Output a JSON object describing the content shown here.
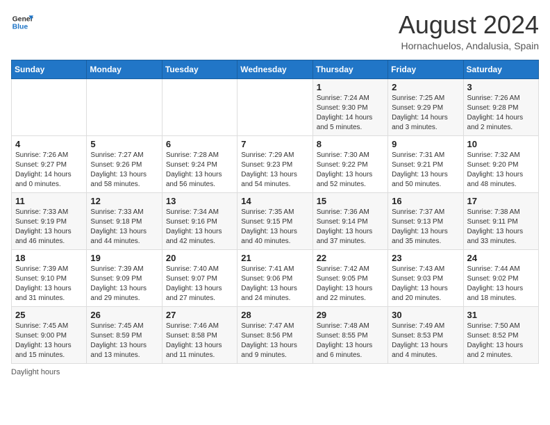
{
  "header": {
    "logo_line1": "General",
    "logo_line2": "Blue",
    "main_title": "August 2024",
    "subtitle": "Hornachuelos, Andalusia, Spain"
  },
  "days_of_week": [
    "Sunday",
    "Monday",
    "Tuesday",
    "Wednesday",
    "Thursday",
    "Friday",
    "Saturday"
  ],
  "weeks": [
    [
      {
        "day": "",
        "info": ""
      },
      {
        "day": "",
        "info": ""
      },
      {
        "day": "",
        "info": ""
      },
      {
        "day": "",
        "info": ""
      },
      {
        "day": "1",
        "info": "Sunrise: 7:24 AM\nSunset: 9:30 PM\nDaylight: 14 hours\nand 5 minutes."
      },
      {
        "day": "2",
        "info": "Sunrise: 7:25 AM\nSunset: 9:29 PM\nDaylight: 14 hours\nand 3 minutes."
      },
      {
        "day": "3",
        "info": "Sunrise: 7:26 AM\nSunset: 9:28 PM\nDaylight: 14 hours\nand 2 minutes."
      }
    ],
    [
      {
        "day": "4",
        "info": "Sunrise: 7:26 AM\nSunset: 9:27 PM\nDaylight: 14 hours\nand 0 minutes."
      },
      {
        "day": "5",
        "info": "Sunrise: 7:27 AM\nSunset: 9:26 PM\nDaylight: 13 hours\nand 58 minutes."
      },
      {
        "day": "6",
        "info": "Sunrise: 7:28 AM\nSunset: 9:24 PM\nDaylight: 13 hours\nand 56 minutes."
      },
      {
        "day": "7",
        "info": "Sunrise: 7:29 AM\nSunset: 9:23 PM\nDaylight: 13 hours\nand 54 minutes."
      },
      {
        "day": "8",
        "info": "Sunrise: 7:30 AM\nSunset: 9:22 PM\nDaylight: 13 hours\nand 52 minutes."
      },
      {
        "day": "9",
        "info": "Sunrise: 7:31 AM\nSunset: 9:21 PM\nDaylight: 13 hours\nand 50 minutes."
      },
      {
        "day": "10",
        "info": "Sunrise: 7:32 AM\nSunset: 9:20 PM\nDaylight: 13 hours\nand 48 minutes."
      }
    ],
    [
      {
        "day": "11",
        "info": "Sunrise: 7:33 AM\nSunset: 9:19 PM\nDaylight: 13 hours\nand 46 minutes."
      },
      {
        "day": "12",
        "info": "Sunrise: 7:33 AM\nSunset: 9:18 PM\nDaylight: 13 hours\nand 44 minutes."
      },
      {
        "day": "13",
        "info": "Sunrise: 7:34 AM\nSunset: 9:16 PM\nDaylight: 13 hours\nand 42 minutes."
      },
      {
        "day": "14",
        "info": "Sunrise: 7:35 AM\nSunset: 9:15 PM\nDaylight: 13 hours\nand 40 minutes."
      },
      {
        "day": "15",
        "info": "Sunrise: 7:36 AM\nSunset: 9:14 PM\nDaylight: 13 hours\nand 37 minutes."
      },
      {
        "day": "16",
        "info": "Sunrise: 7:37 AM\nSunset: 9:13 PM\nDaylight: 13 hours\nand 35 minutes."
      },
      {
        "day": "17",
        "info": "Sunrise: 7:38 AM\nSunset: 9:11 PM\nDaylight: 13 hours\nand 33 minutes."
      }
    ],
    [
      {
        "day": "18",
        "info": "Sunrise: 7:39 AM\nSunset: 9:10 PM\nDaylight: 13 hours\nand 31 minutes."
      },
      {
        "day": "19",
        "info": "Sunrise: 7:39 AM\nSunset: 9:09 PM\nDaylight: 13 hours\nand 29 minutes."
      },
      {
        "day": "20",
        "info": "Sunrise: 7:40 AM\nSunset: 9:07 PM\nDaylight: 13 hours\nand 27 minutes."
      },
      {
        "day": "21",
        "info": "Sunrise: 7:41 AM\nSunset: 9:06 PM\nDaylight: 13 hours\nand 24 minutes."
      },
      {
        "day": "22",
        "info": "Sunrise: 7:42 AM\nSunset: 9:05 PM\nDaylight: 13 hours\nand 22 minutes."
      },
      {
        "day": "23",
        "info": "Sunrise: 7:43 AM\nSunset: 9:03 PM\nDaylight: 13 hours\nand 20 minutes."
      },
      {
        "day": "24",
        "info": "Sunrise: 7:44 AM\nSunset: 9:02 PM\nDaylight: 13 hours\nand 18 minutes."
      }
    ],
    [
      {
        "day": "25",
        "info": "Sunrise: 7:45 AM\nSunset: 9:00 PM\nDaylight: 13 hours\nand 15 minutes."
      },
      {
        "day": "26",
        "info": "Sunrise: 7:45 AM\nSunset: 8:59 PM\nDaylight: 13 hours\nand 13 minutes."
      },
      {
        "day": "27",
        "info": "Sunrise: 7:46 AM\nSunset: 8:58 PM\nDaylight: 13 hours\nand 11 minutes."
      },
      {
        "day": "28",
        "info": "Sunrise: 7:47 AM\nSunset: 8:56 PM\nDaylight: 13 hours\nand 9 minutes."
      },
      {
        "day": "29",
        "info": "Sunrise: 7:48 AM\nSunset: 8:55 PM\nDaylight: 13 hours\nand 6 minutes."
      },
      {
        "day": "30",
        "info": "Sunrise: 7:49 AM\nSunset: 8:53 PM\nDaylight: 13 hours\nand 4 minutes."
      },
      {
        "day": "31",
        "info": "Sunrise: 7:50 AM\nSunset: 8:52 PM\nDaylight: 13 hours\nand 2 minutes."
      }
    ]
  ],
  "footer": {
    "note": "Daylight hours"
  }
}
